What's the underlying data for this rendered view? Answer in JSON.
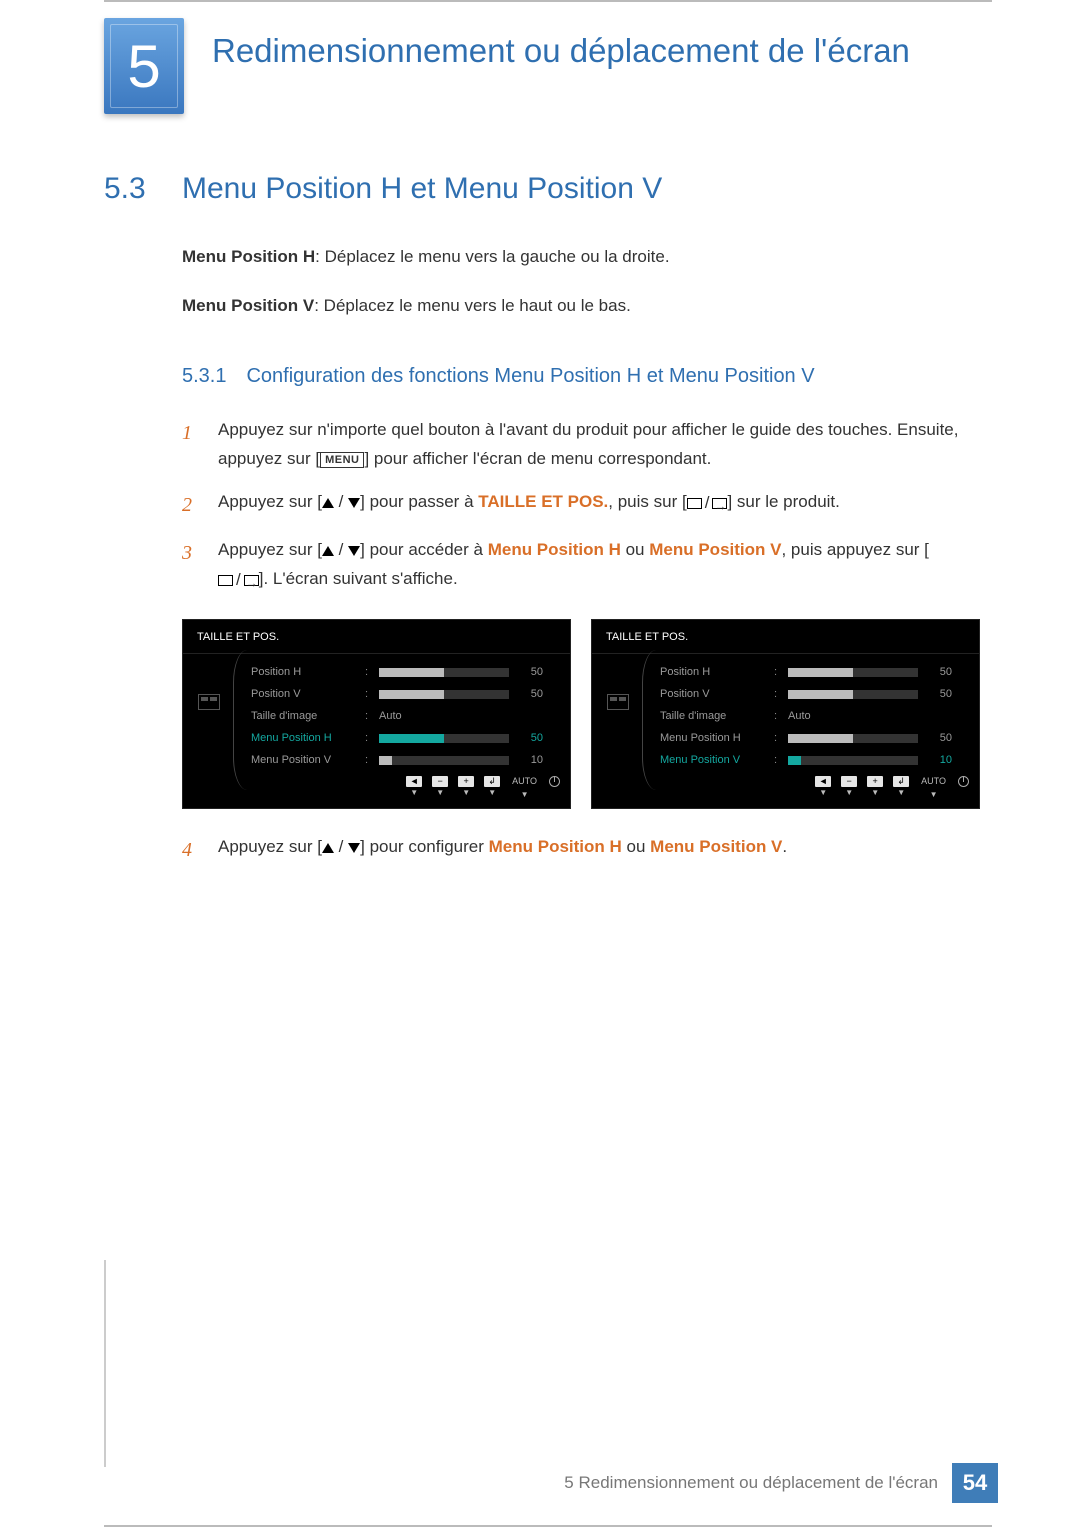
{
  "chapter": {
    "number": "5",
    "title": "Redimensionnement ou déplacement de l'écran"
  },
  "section": {
    "number": "5.3",
    "title": "Menu Position H et Menu Position V"
  },
  "definitions": {
    "h_label": "Menu Position H",
    "h_text": ": Déplacez le menu vers la gauche ou la droite.",
    "v_label": "Menu Position V",
    "v_text": ": Déplacez le menu vers le haut ou le bas."
  },
  "subsection": {
    "number": "5.3.1",
    "title": "Configuration des fonctions Menu Position H et Menu Position V"
  },
  "buttons": {
    "menu": "MENU",
    "auto": "AUTO"
  },
  "steps": {
    "s1_a": "Appuyez sur n'importe quel bouton à l'avant du produit pour afficher le guide des touches. Ensuite, appuyez sur [",
    "s1_b": "] pour afficher l'écran de menu correspondant.",
    "s2_a": "Appuyez sur [",
    "s2_b": "] pour passer à ",
    "s2_t": "TAILLE ET POS.",
    "s2_c": ", puis sur [",
    "s2_d": "] sur le produit.",
    "s3_a": "Appuyez sur [",
    "s3_b": "] pour accéder à ",
    "s3_h": "Menu Position H",
    "s3_or": " ou ",
    "s3_v": "Menu Position V",
    "s3_c": ", puis appuyez sur [",
    "s3_d": "]. L'écran suivant s'affiche.",
    "s4_a": "Appuyez sur [",
    "s4_b": "] pour configurer ",
    "s4_h": "Menu Position H",
    "s4_or": " ou ",
    "s4_v": "Menu Position V",
    "s4_end": "."
  },
  "osd": {
    "title": "TAILLE ET POS.",
    "rows": {
      "posH": {
        "label": "Position H",
        "value": "50",
        "fill": 50
      },
      "posV": {
        "label": "Position V",
        "value": "50",
        "fill": 50
      },
      "imgSize": {
        "label": "Taille d'image",
        "value": "Auto"
      },
      "menuH": {
        "label": "Menu Position H",
        "value": "50",
        "fill": 50
      },
      "menuV": {
        "label": "Menu Position V",
        "value": "10",
        "fill": 10
      }
    },
    "foot": {
      "back": "◄",
      "minus": "−",
      "plus": "+",
      "enter": "↲"
    }
  },
  "footer": {
    "text": "5 Redimensionnement ou déplacement de l'écran",
    "page": "54"
  }
}
